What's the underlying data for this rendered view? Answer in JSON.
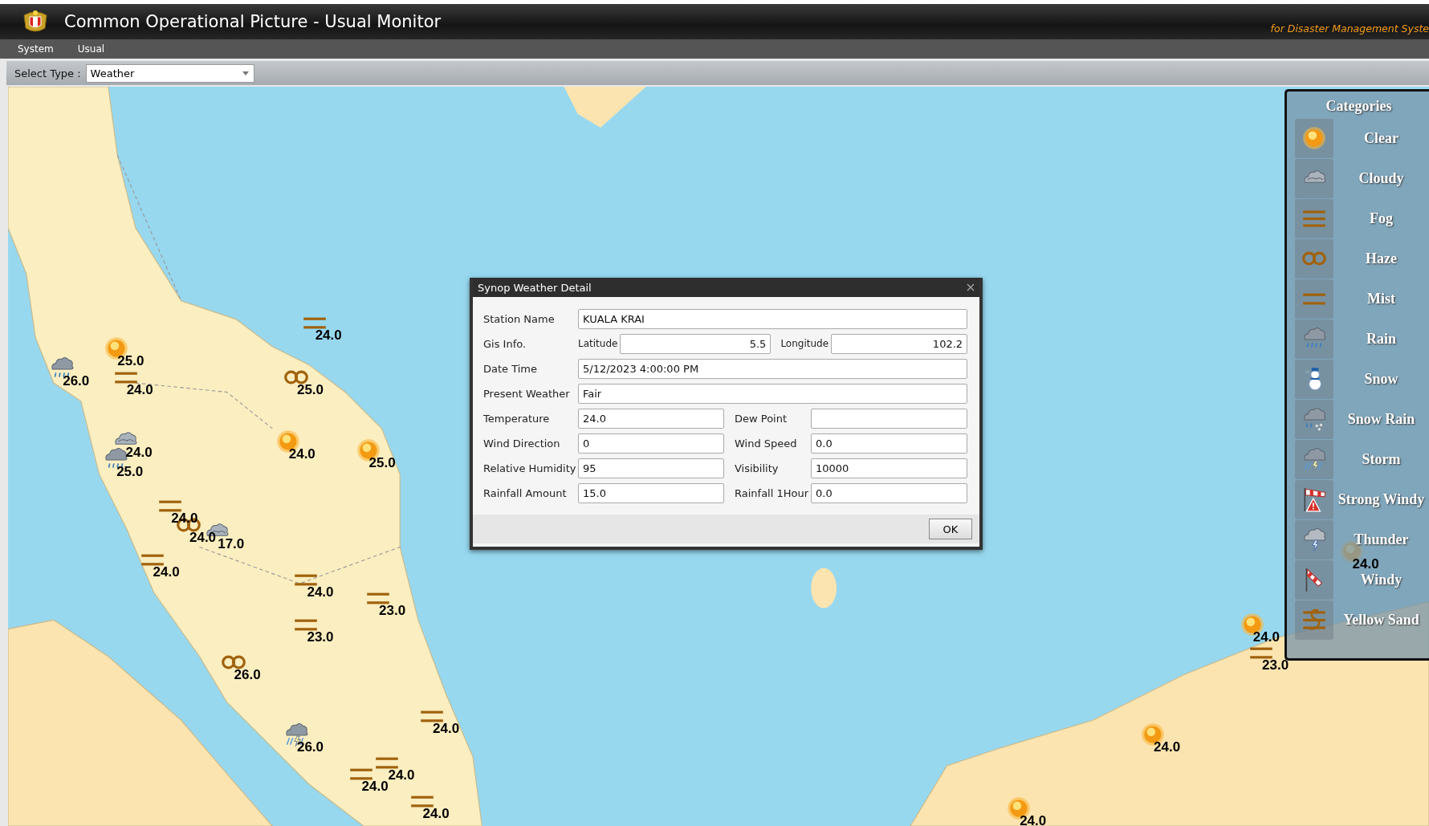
{
  "header": {
    "title": "Common Operational Picture - Usual Monitor",
    "tagline": "for Disaster Management Syste"
  },
  "menu": [
    "System",
    "Usual"
  ],
  "toolbar": {
    "label": "Select Type :",
    "value": "Weather"
  },
  "map": {
    "markers": [
      {
        "kind": "mist",
        "reading": "24.0"
      },
      {
        "kind": "clear",
        "reading": "25.0"
      },
      {
        "kind": "rain",
        "reading": "26.0"
      },
      {
        "kind": "mist",
        "reading": "24.0"
      },
      {
        "kind": "haze",
        "reading": "25.0"
      },
      {
        "kind": "clear",
        "reading": "24.0"
      },
      {
        "kind": "clear",
        "reading": "25.0"
      },
      {
        "kind": "cloudy",
        "reading": "24.0"
      },
      {
        "kind": "rain",
        "reading": "25.0"
      },
      {
        "kind": "mist",
        "reading": "24.0"
      },
      {
        "kind": "haze",
        "reading": "24.0"
      },
      {
        "kind": "cloudy",
        "reading": "17.0"
      },
      {
        "kind": "mist",
        "reading": "24.0"
      },
      {
        "kind": "mist",
        "reading": "24.0"
      },
      {
        "kind": "mist",
        "reading": "23.0"
      },
      {
        "kind": "mist",
        "reading": "23.0"
      },
      {
        "kind": "haze",
        "reading": "26.0"
      },
      {
        "kind": "storm",
        "reading": "26.0"
      },
      {
        "kind": "mist",
        "reading": "24.0"
      },
      {
        "kind": "mist",
        "reading": "24.0"
      },
      {
        "kind": "mist",
        "reading": "24.0"
      },
      {
        "kind": "mist",
        "reading": "24.0"
      },
      {
        "kind": "clear",
        "reading": "24.0"
      },
      {
        "kind": "mist",
        "reading": "23.0"
      },
      {
        "kind": "clear",
        "reading": "24.0"
      },
      {
        "kind": "clear",
        "reading": "24.0"
      },
      {
        "kind": "clear",
        "reading": "24.0"
      }
    ]
  },
  "dialog": {
    "title": "Synop Weather Detail",
    "rows": [
      {
        "kind": "wide",
        "label": "Station Name",
        "value": "KUALA KRAI"
      },
      {
        "kind": "gis",
        "label": "Gis Info.",
        "latitude": {
          "label": "Latitude",
          "value": "5.5"
        },
        "longitude": {
          "label": "Longitude",
          "value": "102.2"
        }
      },
      {
        "kind": "wide",
        "label": "Date Time",
        "value": "5/12/2023 4:00:00 PM"
      },
      {
        "kind": "wide",
        "label": "Present Weather",
        "value": "Fair"
      },
      {
        "kind": "pair",
        "left": {
          "label": "Temperature",
          "value": "24.0"
        },
        "right": {
          "label": "Dew Point"
        }
      },
      {
        "kind": "pair",
        "left": {
          "label": "Wind Direction",
          "value": "0"
        },
        "right": {
          "label": "Wind Speed",
          "value": "0.0"
        }
      },
      {
        "kind": "pair",
        "left": {
          "label": "Relative Humidity",
          "value": "95"
        },
        "right": {
          "label": "Visibility",
          "value": "10000"
        }
      },
      {
        "kind": "pair",
        "left": {
          "label": "Rainfall Amount",
          "value": "15.0"
        },
        "right": {
          "label": "Rainfall 1Hour",
          "value": "0.0"
        }
      }
    ],
    "button": "OK"
  },
  "categories": {
    "title": "Categories",
    "items": [
      {
        "kind": "clear",
        "label": "Clear"
      },
      {
        "kind": "cloudy",
        "label": "Cloudy"
      },
      {
        "kind": "fog",
        "label": "Fog"
      },
      {
        "kind": "haze",
        "label": "Haze"
      },
      {
        "kind": "mist",
        "label": "Mist"
      },
      {
        "kind": "rain",
        "label": "Rain"
      },
      {
        "kind": "snow",
        "label": "Snow"
      },
      {
        "kind": "snow_rain",
        "label": "Snow Rain"
      },
      {
        "kind": "storm",
        "label": "Storm"
      },
      {
        "kind": "strong_windy",
        "label": "Strong Windy"
      },
      {
        "kind": "thunder",
        "label": "Thunder"
      },
      {
        "kind": "windy",
        "label": "Windy"
      },
      {
        "kind": "yellow_sand",
        "label": "Yellow Sand"
      }
    ]
  }
}
